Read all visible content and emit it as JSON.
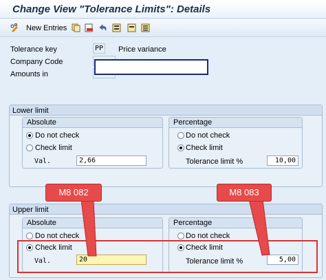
{
  "window": {
    "title": "Change View \"Tolerance Limits\": Details"
  },
  "toolbar": {
    "new_entries_label": "New Entries",
    "icons": [
      "pencil-glasses-icon",
      "copy-icon",
      "delete-icon",
      "undo-icon",
      "select-all-icon",
      "deselect-icon",
      "block-select-icon"
    ]
  },
  "header": {
    "tolerance_key_label": "Tolerance key",
    "tolerance_key_value": "PP",
    "tolerance_key_text": "Price variance",
    "company_code_label": "Company Code",
    "amounts_in_label": "Amounts in"
  },
  "lower": {
    "title": "Lower limit",
    "absolute": {
      "title": "Absolute",
      "do_not_check": "Do not check",
      "check_limit": "Check limit",
      "val_label": "Val.",
      "val_value": "2,66"
    },
    "percentage": {
      "title": "Percentage",
      "do_not_check": "Do not check",
      "check_limit": "Check limit",
      "tol_label": "Tolerance limit %",
      "tol_value": "10,00"
    }
  },
  "upper": {
    "title": "Upper limit",
    "absolute": {
      "title": "Absolute",
      "do_not_check": "Do not check",
      "check_limit": "Check limit",
      "val_label": "Val.",
      "val_value": "20"
    },
    "percentage": {
      "title": "Percentage",
      "do_not_check": "Do not check",
      "check_limit": "Check limit",
      "tol_label": "Tolerance limit %",
      "tol_value": "5,00"
    }
  },
  "callouts": {
    "left": "M8 082",
    "right": "M8 083"
  },
  "colors": {
    "callout": "#e64a4a",
    "frame": "#d73232",
    "highlight_field": "#fdf6b4"
  }
}
